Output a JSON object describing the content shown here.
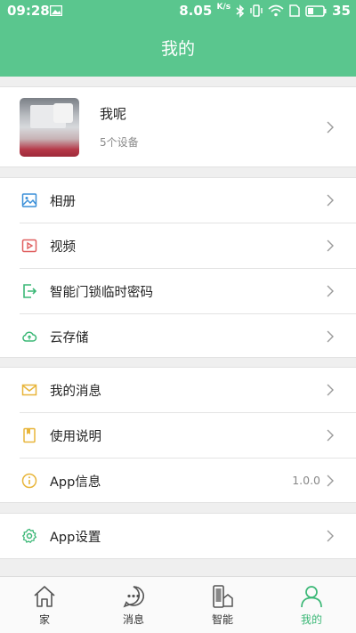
{
  "status_bar": {
    "time": "09:28",
    "speed": "8.05",
    "speed_unit": "K/s",
    "battery": "35"
  },
  "header": {
    "title": "我的"
  },
  "profile": {
    "name": "我呢",
    "device_count": "5个设备"
  },
  "menu_group_1": [
    {
      "label": "相册",
      "icon": "album-icon"
    },
    {
      "label": "视频",
      "icon": "video-icon"
    },
    {
      "label": "智能门锁临时密码",
      "icon": "door-lock-icon"
    },
    {
      "label": "云存储",
      "icon": "cloud-storage-icon"
    }
  ],
  "menu_group_2": [
    {
      "label": "我的消息",
      "icon": "mail-icon"
    },
    {
      "label": "使用说明",
      "icon": "manual-icon"
    },
    {
      "label": "App信息",
      "value": "1.0.0",
      "icon": "info-icon"
    }
  ],
  "menu_group_3": [
    {
      "label": "App设置",
      "icon": "settings-icon"
    }
  ],
  "tabs": [
    {
      "label": "家",
      "icon": "home-icon"
    },
    {
      "label": "消息",
      "icon": "message-icon"
    },
    {
      "label": "智能",
      "icon": "smart-device-icon"
    },
    {
      "label": "我的",
      "icon": "profile-icon",
      "active": true
    }
  ],
  "colors": {
    "primary": "#5ac68e",
    "active_tab": "#3cb877",
    "background": "#efefef"
  }
}
